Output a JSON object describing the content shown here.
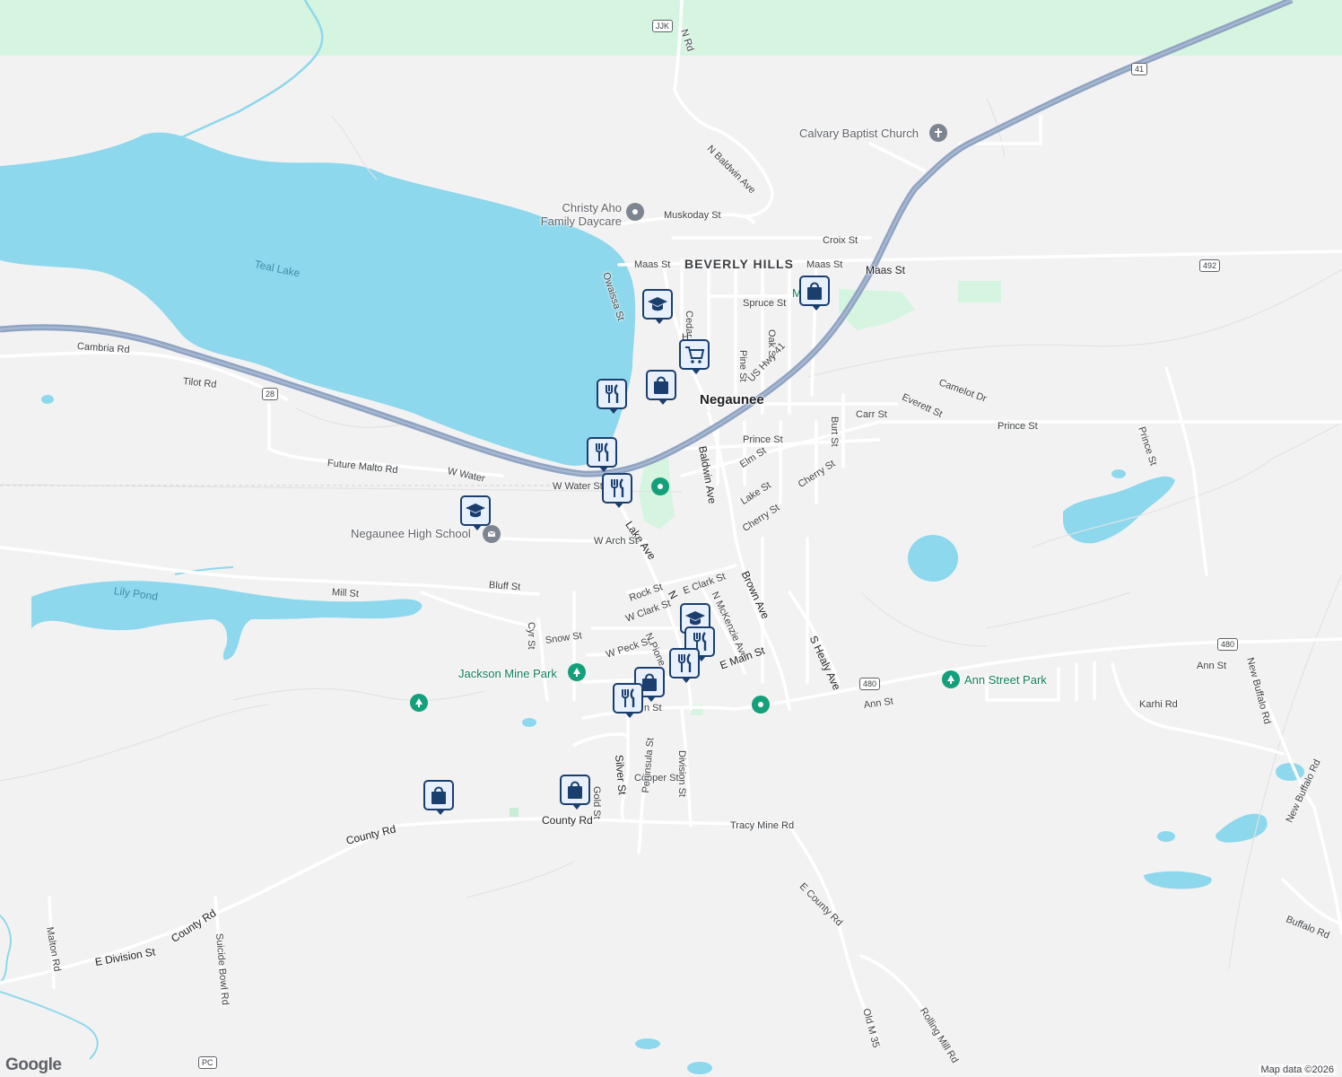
{
  "map": {
    "colors": {
      "background": "#f3f2f3",
      "water": "#8dd8ec",
      "park_green": "#d6f5e0",
      "highway": "#8fa4c3",
      "road": "#ffffff",
      "pin_border": "#1a3f6e"
    },
    "places": {
      "city": "Negaunee",
      "neighborhood": "BEVERLY HILLS",
      "poi_daycare": "Christy Aho Family Daycare",
      "poi_church": "Calvary Baptist Church",
      "poi_school": "Negaunee High School",
      "park_jackson": "Jackson Mine Park",
      "park_ann": "Ann Street Park",
      "park_m": "M     Park"
    },
    "water": {
      "teal_lake": "Teal Lake",
      "lily_pond": "Lily Pond"
    },
    "shields": {
      "jjk": "JJK",
      "us41": "41",
      "m28": "28",
      "r492": "492",
      "r480a": "480",
      "r480b": "480",
      "pc": "PC"
    },
    "streets": {
      "n_rd": "N Rd",
      "n_baldwin_ave": "N Baldwin Ave",
      "muskoday": "Muskoday St",
      "croix": "Croix St",
      "maas1": "Maas St",
      "maas2": "Maas St",
      "maas3": "Maas St",
      "owaissa": "Owaissa St",
      "cedar": "Cedar",
      "spruce": "Spruce St",
      "pine": "Pine St",
      "oak": "Oak St",
      "us_hwy_41": "US Hwy 41",
      "cambria": "Cambria Rd",
      "tilot": "Tilot Rd",
      "everett": "Everett St",
      "camelot": "Camelot Dr",
      "burt": "Burt St",
      "carr": "Carr St",
      "baldwin": "Baldwin Ave",
      "prince1": "Prince St",
      "prince2": "Prince St",
      "prince3": "Prince St",
      "elm": "Elm St",
      "future_malto": "Future Malto Rd",
      "w_water": "W Water",
      "w_water_st": "W Water St",
      "lake_st": "Lake St",
      "cherry1": "Cherry St",
      "cherry2": "Cherry St",
      "lake_ave": "Lake Ave",
      "w_arch": "W Arch St",
      "brown": "Brown Ave",
      "bluff": "Bluff St",
      "mill": "Mill St",
      "rock": "Rock St",
      "e_clark": "E Clark St",
      "w_clark": "W Clark St",
      "n_mckenzie": "N McKenzie Ave",
      "s_healy": "S Healy Ave",
      "cyr": "Cyr St",
      "snow": "Snow St",
      "w_peck": "W Peck St",
      "n_pioneer": "N Pione",
      "e_main": "E Main St",
      "ann1": "Ann St",
      "ann2": "Ann St",
      "karhi": "Karhi Rd",
      "new_buffalo1": "New Buffalo Rd",
      "new_buffalo2": "New Buffalo Rd",
      "silver": "Silver St",
      "gold": "Gold St",
      "division": "Division St",
      "copper": "Copper St",
      "peninsula": "Peninsula St",
      "county_rd1": "County Rd",
      "county_rd2": "County Rd",
      "county_rd3": "County Rd",
      "tracy_mine": "Tracy Mine Rd",
      "e_county": "E County Rd",
      "buffalo": "Buffalo Rd",
      "malton": "Malton Rd",
      "suicide_bowl": "Suicide Bowl Rd",
      "e_division": "E Division St",
      "old_m35": "Old M 35",
      "rolling_mill": "Rolling Mill Rd",
      "w_main": "n St",
      "n_label": "N",
      "h_label": "H"
    },
    "pins": [
      {
        "icon": "graduation-cap-icon"
      },
      {
        "icon": "shopping-cart-icon"
      },
      {
        "icon": "shopping-bag-icon"
      },
      {
        "icon": "utensils-icon"
      },
      {
        "icon": "utensils-icon"
      },
      {
        "icon": "utensils-icon"
      },
      {
        "icon": "graduation-cap-icon"
      },
      {
        "icon": "shopping-bag-icon"
      },
      {
        "icon": "graduation-cap-icon"
      },
      {
        "icon": "utensils-icon"
      },
      {
        "icon": "utensils-icon"
      },
      {
        "icon": "shopping-bag-icon"
      },
      {
        "icon": "utensils-icon"
      },
      {
        "icon": "shopping-bag-icon"
      },
      {
        "icon": "shopping-bag-icon"
      }
    ],
    "footer": {
      "logo": "Google",
      "attribution": "Map data ©2026"
    }
  }
}
